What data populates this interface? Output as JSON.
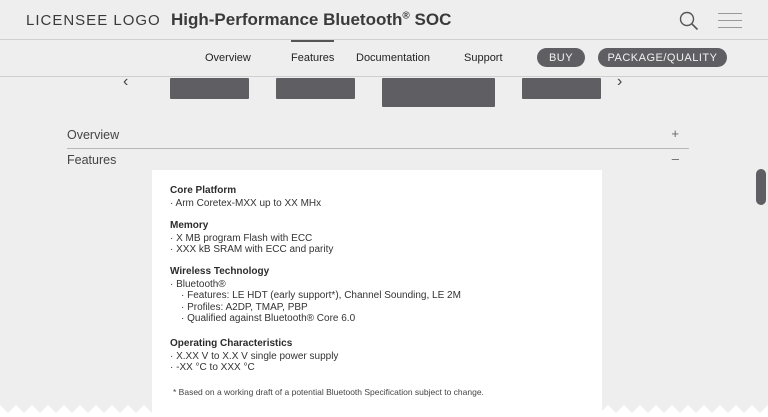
{
  "header": {
    "logo": "LICENSEE LOGO",
    "title": "High-Performance Bluetooth",
    "title_sup": "®",
    "title_suffix": " SOC"
  },
  "nav": {
    "links": [
      "Overview",
      "Features",
      "Documentation",
      "Support"
    ],
    "active": "Features",
    "buy": "BUY",
    "package": "PACKAGE/QUALITY"
  },
  "accordion": {
    "overview": {
      "label": "Overview",
      "sign": "+"
    },
    "features": {
      "label": "Features",
      "sign": "–"
    }
  },
  "features": {
    "core_platform": {
      "heading": "Core Platform",
      "items": [
        "· Arm Coretex-MXX up to XX MHx"
      ]
    },
    "memory": {
      "heading": "Memory",
      "items": [
        "· X MB program Flash with ECC",
        "· XXX kB SRAM with ECC and parity"
      ]
    },
    "wireless": {
      "heading": "Wireless Technology",
      "item": "· Bluetooth®",
      "sub_items": [
        "· Features: LE HDT (early support*), Channel Sounding, LE 2M",
        "· Profiles: A2DP, TMAP, PBP",
        "· Qualified against Bluetooth® Core 6.0"
      ]
    },
    "operating": {
      "heading": "Operating Characteristics",
      "items": [
        "· X.XX V to X.X V single power supply",
        "· -XX °C to XXX °C"
      ]
    },
    "footnote": "* Based on a working draft of a potential Bluetooth Specification subject to change."
  },
  "colors": {
    "pill": "#5f5f63",
    "background": "#eeeeee",
    "panel": "#ffffff"
  }
}
